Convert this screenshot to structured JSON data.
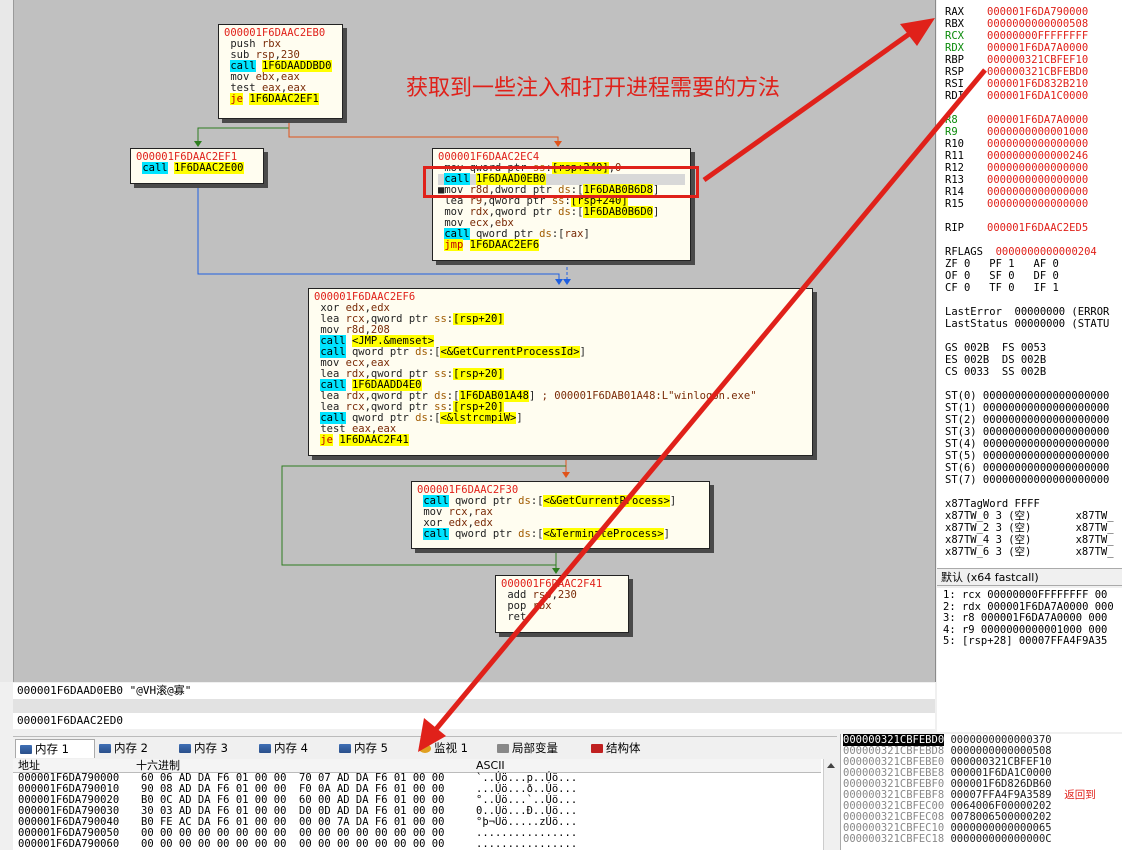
{
  "graph": {
    "nodes": [
      {
        "id": "n1",
        "addr": "000001F6DAAC2EB0",
        "lines": [
          [
            {
              "t": " push "
            },
            {
              "t": "rbx",
              "c": "reg"
            }
          ],
          [
            {
              "t": " sub "
            },
            {
              "t": "rsp",
              "c": "reg"
            },
            {
              "t": ","
            },
            {
              "t": "230",
              "c": "num"
            }
          ],
          [
            {
              "t": " "
            },
            {
              "t": "call",
              "c": "call"
            },
            {
              "t": " "
            },
            {
              "t": "1F6DAADDBD0",
              "c": "hl"
            }
          ],
          [
            {
              "t": " mov "
            },
            {
              "t": "ebx",
              "c": "reg"
            },
            {
              "t": ","
            },
            {
              "t": "eax",
              "c": "reg"
            }
          ],
          [
            {
              "t": " test "
            },
            {
              "t": "eax",
              "c": "reg"
            },
            {
              "t": ","
            },
            {
              "t": "eax",
              "c": "reg"
            }
          ],
          [
            {
              "t": " "
            },
            {
              "t": "je",
              "c": "jmp"
            },
            {
              "t": " "
            },
            {
              "t": "1F6DAAC2EF1",
              "c": "hl"
            }
          ]
        ]
      },
      {
        "id": "n2",
        "addr": "000001F6DAAC2EF1",
        "lines": [
          [
            {
              "t": " "
            },
            {
              "t": "call",
              "c": "call"
            },
            {
              "t": " "
            },
            {
              "t": "1F6DAAC2E00",
              "c": "hl"
            }
          ]
        ]
      },
      {
        "id": "n3",
        "addr": "000001F6DAAC2EC4",
        "lines": [
          [
            {
              "t": " mov qword ptr "
            },
            {
              "t": "ss",
              "c": "seg"
            },
            {
              "t": ":"
            },
            {
              "t": "[rsp+240]",
              "c": "bx"
            },
            {
              "t": ","
            },
            {
              "t": "0",
              "c": "num"
            }
          ],
          [
            {
              "t": " "
            },
            {
              "t": "call",
              "c": "call"
            },
            {
              "t": " "
            },
            {
              "t": "1F6DAAD0EB0",
              "c": "hl"
            }
          ],
          [
            {
              "t": "■mov "
            },
            {
              "t": "r8d",
              "c": "reg"
            },
            {
              "t": ",dword ptr "
            },
            {
              "t": "ds",
              "c": "seg"
            },
            {
              "t": ":["
            },
            {
              "t": "1F6DAB0B6D8",
              "c": "hl"
            },
            {
              "t": "]"
            }
          ],
          [
            {
              "t": " lea "
            },
            {
              "t": "r9",
              "c": "reg"
            },
            {
              "t": ",qword ptr "
            },
            {
              "t": "ss",
              "c": "seg"
            },
            {
              "t": ":"
            },
            {
              "t": "[rsp+240]",
              "c": "bx"
            }
          ],
          [
            {
              "t": " mov "
            },
            {
              "t": "rdx",
              "c": "reg"
            },
            {
              "t": ",qword ptr "
            },
            {
              "t": "ds",
              "c": "seg"
            },
            {
              "t": ":["
            },
            {
              "t": "1F6DAB0B6D0",
              "c": "hl"
            },
            {
              "t": "]"
            }
          ],
          [
            {
              "t": " mov "
            },
            {
              "t": "ecx",
              "c": "reg"
            },
            {
              "t": ","
            },
            {
              "t": "ebx",
              "c": "reg"
            }
          ],
          [
            {
              "t": " "
            },
            {
              "t": "call",
              "c": "call"
            },
            {
              "t": " qword ptr "
            },
            {
              "t": "ds",
              "c": "seg"
            },
            {
              "t": ":["
            },
            {
              "t": "rax",
              "c": "reg"
            },
            {
              "t": "]"
            }
          ],
          [
            {
              "t": " "
            },
            {
              "t": "jmp",
              "c": "jmp"
            },
            {
              "t": " "
            },
            {
              "t": "1F6DAAC2EF6",
              "c": "hl"
            }
          ]
        ]
      },
      {
        "id": "n4",
        "addr": "000001F6DAAC2EF6",
        "lines": [
          [
            {
              "t": " xor "
            },
            {
              "t": "edx",
              "c": "reg"
            },
            {
              "t": ","
            },
            {
              "t": "edx",
              "c": "reg"
            }
          ],
          [
            {
              "t": " lea "
            },
            {
              "t": "rcx",
              "c": "reg"
            },
            {
              "t": ",qword ptr "
            },
            {
              "t": "ss",
              "c": "seg"
            },
            {
              "t": ":"
            },
            {
              "t": "[rsp+20]",
              "c": "bx"
            }
          ],
          [
            {
              "t": " mov "
            },
            {
              "t": "r8d",
              "c": "reg"
            },
            {
              "t": ","
            },
            {
              "t": "208",
              "c": "num"
            }
          ],
          [
            {
              "t": " "
            },
            {
              "t": "call",
              "c": "call"
            },
            {
              "t": " "
            },
            {
              "t": "<JMP.&memset>",
              "c": "hl"
            }
          ],
          [
            {
              "t": " "
            },
            {
              "t": "call",
              "c": "call"
            },
            {
              "t": " qword ptr "
            },
            {
              "t": "ds",
              "c": "seg"
            },
            {
              "t": ":["
            },
            {
              "t": "<&GetCurrentProcessId>",
              "c": "hl"
            },
            {
              "t": "]"
            }
          ],
          [
            {
              "t": " mov "
            },
            {
              "t": "ecx",
              "c": "reg"
            },
            {
              "t": ","
            },
            {
              "t": "eax",
              "c": "reg"
            }
          ],
          [
            {
              "t": " lea "
            },
            {
              "t": "rdx",
              "c": "reg"
            },
            {
              "t": ",qword ptr "
            },
            {
              "t": "ss",
              "c": "seg"
            },
            {
              "t": ":"
            },
            {
              "t": "[rsp+20]",
              "c": "bx"
            }
          ],
          [
            {
              "t": " "
            },
            {
              "t": "call",
              "c": "call"
            },
            {
              "t": " "
            },
            {
              "t": "1F6DAADD4E0",
              "c": "hl"
            }
          ],
          [
            {
              "t": " lea "
            },
            {
              "t": "rdx",
              "c": "reg"
            },
            {
              "t": ",qword ptr "
            },
            {
              "t": "ds",
              "c": "seg"
            },
            {
              "t": ":["
            },
            {
              "t": "1F6DAB01A48",
              "c": "hl"
            },
            {
              "t": "] "
            },
            {
              "t": "; 000001F6DAB01A48:L\"winlogon.exe\"",
              "c": "cmt"
            }
          ],
          [
            {
              "t": " lea "
            },
            {
              "t": "rcx",
              "c": "reg"
            },
            {
              "t": ",qword ptr "
            },
            {
              "t": "ss",
              "c": "seg"
            },
            {
              "t": ":"
            },
            {
              "t": "[rsp+20]",
              "c": "bx"
            }
          ],
          [
            {
              "t": " "
            },
            {
              "t": "call",
              "c": "call"
            },
            {
              "t": " qword ptr "
            },
            {
              "t": "ds",
              "c": "seg"
            },
            {
              "t": ":["
            },
            {
              "t": "<&lstrcmpiW>",
              "c": "hl"
            },
            {
              "t": "]"
            }
          ],
          [
            {
              "t": " test "
            },
            {
              "t": "eax",
              "c": "reg"
            },
            {
              "t": ","
            },
            {
              "t": "eax",
              "c": "reg"
            }
          ],
          [
            {
              "t": " "
            },
            {
              "t": "je",
              "c": "jmp"
            },
            {
              "t": " "
            },
            {
              "t": "1F6DAAC2F41",
              "c": "hl"
            }
          ]
        ]
      },
      {
        "id": "n5",
        "addr": "000001F6DAAC2F30",
        "lines": [
          [
            {
              "t": " "
            },
            {
              "t": "call",
              "c": "call"
            },
            {
              "t": " qword ptr "
            },
            {
              "t": "ds",
              "c": "seg"
            },
            {
              "t": ":["
            },
            {
              "t": "<&GetCurrentProcess>",
              "c": "hl"
            },
            {
              "t": "]"
            }
          ],
          [
            {
              "t": " mov "
            },
            {
              "t": "rcx",
              "c": "reg"
            },
            {
              "t": ","
            },
            {
              "t": "rax",
              "c": "reg"
            }
          ],
          [
            {
              "t": " xor "
            },
            {
              "t": "edx",
              "c": "reg"
            },
            {
              "t": ","
            },
            {
              "t": "edx",
              "c": "reg"
            }
          ],
          [
            {
              "t": " "
            },
            {
              "t": "call",
              "c": "call"
            },
            {
              "t": " qword ptr "
            },
            {
              "t": "ds",
              "c": "seg"
            },
            {
              "t": ":["
            },
            {
              "t": "<&TerminateProcess>",
              "c": "hl"
            },
            {
              "t": "]"
            }
          ]
        ]
      },
      {
        "id": "n6",
        "addr": "000001F6DAAC2F41",
        "lines": [
          [
            {
              "t": " add "
            },
            {
              "t": "rsp",
              "c": "reg"
            },
            {
              "t": ","
            },
            {
              "t": "230",
              "c": "num"
            }
          ],
          [
            {
              "t": " pop "
            },
            {
              "t": "rbx",
              "c": "reg"
            }
          ],
          [
            {
              "t": " ret"
            }
          ]
        ]
      }
    ]
  },
  "annotation": "获取到一些注入和打开进程需要的方法",
  "info": {
    "line1": "000001F6DAAD0EB0  \"@VH滚@寡\"",
    "line2": "000001F6DAAC2ED0"
  },
  "registers": [
    {
      "n": "RAX",
      "v": "000001F6DA790000",
      "changed": false
    },
    {
      "n": "RBX",
      "v": "0000000000000508",
      "changed": false
    },
    {
      "n": "RCX",
      "v": "00000000FFFFFFFF",
      "changed": true
    },
    {
      "n": "RDX",
      "v": "000001F6DA7A0000",
      "changed": true
    },
    {
      "n": "RBP",
      "v": "000000321CBFEF10",
      "changed": false
    },
    {
      "n": "RSP",
      "v": "000000321CBFEBD0",
      "changed": false
    },
    {
      "n": "RSI",
      "v": "000001F6D832B210",
      "changed": false
    },
    {
      "n": "RDI",
      "v": "000001F6DA1C0000",
      "changed": false
    },
    {
      "n": "",
      "v": "",
      "changed": false
    },
    {
      "n": "R8",
      "v": "000001F6DA7A0000",
      "changed": true
    },
    {
      "n": "R9",
      "v": "0000000000001000",
      "changed": true
    },
    {
      "n": "R10",
      "v": "0000000000000000",
      "changed": false
    },
    {
      "n": "R11",
      "v": "0000000000000246",
      "changed": false
    },
    {
      "n": "R12",
      "v": "0000000000000000",
      "changed": false
    },
    {
      "n": "R13",
      "v": "0000000000000000",
      "changed": false
    },
    {
      "n": "R14",
      "v": "0000000000000000",
      "changed": false
    },
    {
      "n": "R15",
      "v": "0000000000000000",
      "changed": false
    },
    {
      "n": "",
      "v": "",
      "changed": false
    },
    {
      "n": "RIP",
      "v": "000001F6DAAC2ED5",
      "changed": false
    }
  ],
  "rflags": {
    "label": "RFLAGS",
    "value": "0000000000000204"
  },
  "flags": [
    "ZF 0   PF 1   AF 0",
    "OF 0   SF 0   DF 0",
    "CF 0   TF 0   IF 1"
  ],
  "lasterror": [
    "LastError  00000000 (ERROR",
    "LastStatus 00000000 (STATU"
  ],
  "segs": [
    "GS 002B  FS 0053",
    "ES 002B  DS 002B",
    "CS 0033  SS 002B"
  ],
  "fpu": [
    "ST(0) 00000000000000000000",
    "ST(1) 00000000000000000000",
    "ST(2) 00000000000000000000",
    "ST(3) 00000000000000000000",
    "ST(4) 00000000000000000000",
    "ST(5) 00000000000000000000",
    "ST(6) 00000000000000000000",
    "ST(7) 00000000000000000000"
  ],
  "tag": [
    "x87TagWord FFFF",
    "x87TW_0 3 (空)       x87TW_",
    "x87TW_2 3 (空)       x87TW_",
    "x87TW_4 3 (空)       x87TW_",
    "x87TW_6 3 (空)       x87TW_"
  ],
  "callconv": "默认 (x64 fastcall)",
  "args": [
    "1: rcx 00000000FFFFFFFF 00",
    "2: rdx 000001F6DA7A0000 000",
    "3: r8 000001F6DA7A0000 000",
    "4: r9 0000000000001000 000",
    "5: [rsp+28] 00007FFA4F9A35"
  ],
  "tabs": [
    {
      "label": "内存 1",
      "active": true,
      "icon": "memory-icon"
    },
    {
      "label": "内存 2",
      "active": false,
      "icon": "memory-icon"
    },
    {
      "label": "内存 3",
      "active": false,
      "icon": "memory-icon"
    },
    {
      "label": "内存 4",
      "active": false,
      "icon": "memory-icon"
    },
    {
      "label": "内存 5",
      "active": false,
      "icon": "memory-icon"
    },
    {
      "label": "监视 1",
      "active": false,
      "icon": "watch-icon"
    },
    {
      "label": "局部变量",
      "active": false,
      "icon": "locals-icon"
    },
    {
      "label": "结构体",
      "active": false,
      "icon": "struct-icon"
    }
  ],
  "dump": {
    "headers": {
      "addr": "地址",
      "hex": "十六进制",
      "ascii": "ASCII"
    },
    "rows": [
      {
        "a": "000001F6DA790000",
        "h": "60 06 AD DA F6 01 00 00  70 07 AD DA F6 01 00 00",
        "s": "`..Úö...p..Úö..."
      },
      {
        "a": "000001F6DA790010",
        "h": "90 08 AD DA F6 01 00 00  F0 0A AD DA F6 01 00 00",
        "s": "...Úö...ð..Úö..."
      },
      {
        "a": "000001F6DA790020",
        "h": "B0 0C AD DA F6 01 00 00  60 00 AD DA F6 01 00 00",
        "s": "°..Úö...`..Úö..."
      },
      {
        "a": "000001F6DA790030",
        "h": "30 03 AD DA F6 01 00 00  D0 0D AD DA F6 01 00 00",
        "s": "0..Úö...Ð..Úö..."
      },
      {
        "a": "000001F6DA790040",
        "h": "B0 FE AC DA F6 01 00 00  00 00 7A DA F6 01 00 00",
        "s": "°þ¬Úö.....zÚö..."
      },
      {
        "a": "000001F6DA790050",
        "h": "00 00 00 00 00 00 00 00  00 00 00 00 00 00 00 00",
        "s": "................"
      },
      {
        "a": "000001F6DA790060",
        "h": "00 00 00 00 00 00 00 00  00 00 00 00 00 00 00 00",
        "s": "................"
      }
    ]
  },
  "stack": {
    "rows": [
      {
        "a": "000000321CBFEBD0",
        "v": "0000000000000370",
        "sel": true,
        "c": ""
      },
      {
        "a": "000000321CBFEBD8",
        "v": "0000000000000508",
        "sel": false,
        "c": ""
      },
      {
        "a": "000000321CBFEBE0",
        "v": "000000321CBFEF10",
        "sel": false,
        "c": ""
      },
      {
        "a": "000000321CBFEBE8",
        "v": "000001F6DA1C0000",
        "sel": false,
        "c": ""
      },
      {
        "a": "000000321CBFEBF0",
        "v": "000001F6D826DB60",
        "sel": false,
        "c": ""
      },
      {
        "a": "000000321CBFEBF8",
        "v": "00007FFA4F9A3589",
        "sel": false,
        "c": "返回到"
      },
      {
        "a": "000000321CBFEC00",
        "v": "0064006F00000202",
        "sel": false,
        "c": ""
      },
      {
        "a": "000000321CBFEC08",
        "v": "0078006500000202",
        "sel": false,
        "c": ""
      },
      {
        "a": "000000321CBFEC10",
        "v": "0000000000000065",
        "sel": false,
        "c": ""
      },
      {
        "a": "000000321CBFEC18",
        "v": "000000000000000C",
        "sel": false,
        "c": ""
      }
    ]
  },
  "colors": {
    "annotation": "#e0211a",
    "edge_true": "#2e7d1f",
    "edge_false": "#e0531a",
    "edge_jump": "#1f5fe0"
  }
}
